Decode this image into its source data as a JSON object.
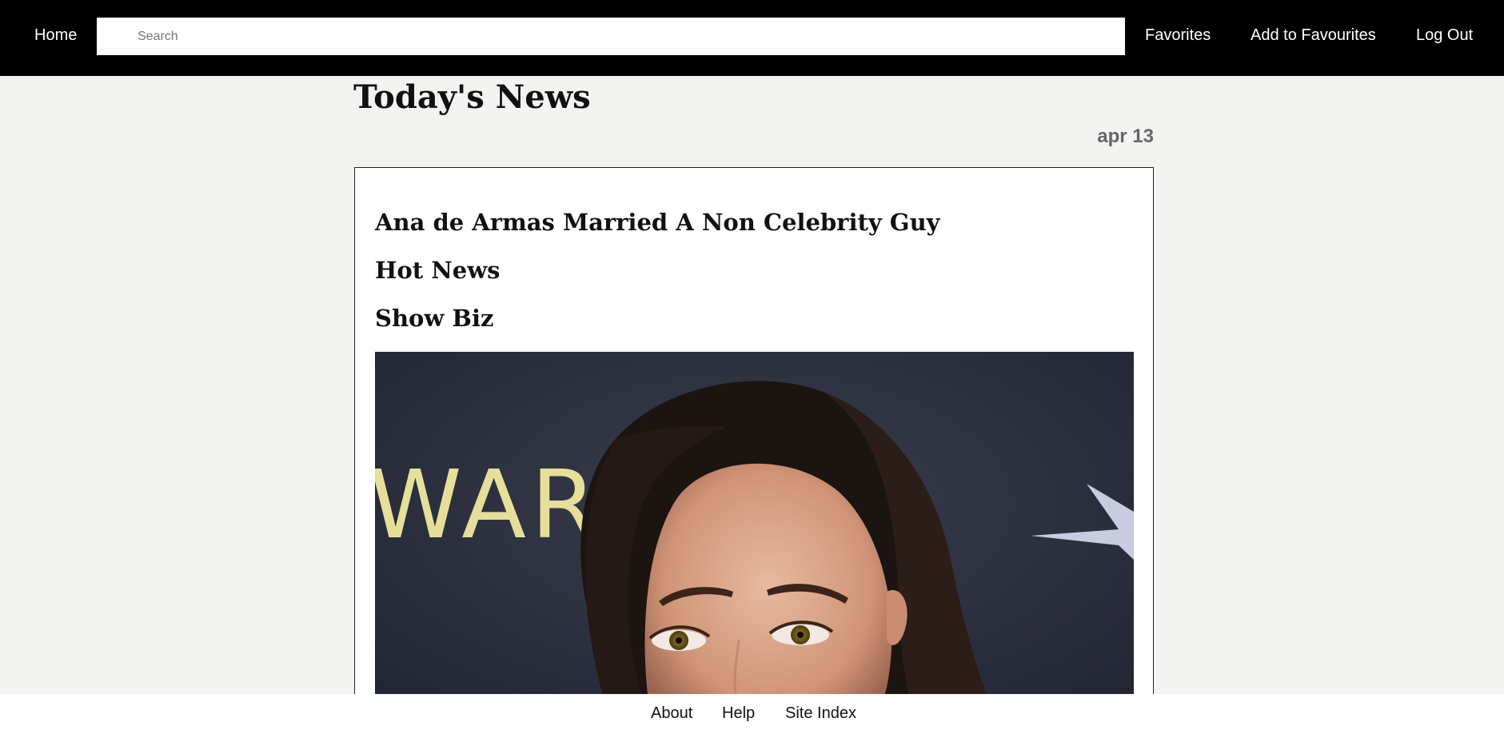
{
  "nav": {
    "home": "Home",
    "search_placeholder": "Search",
    "search_value": "",
    "favorites": "Favorites",
    "add_to_favourites": "Add to Favourites",
    "log_out": "Log Out"
  },
  "page": {
    "title": "Today's News",
    "date": "apr 13"
  },
  "article": {
    "headline": "Ana de Armas Married A Non Celebrity Guy",
    "category": "Hot News",
    "section": "Show Biz",
    "image": {
      "subject": "woman-portrait-photo",
      "backdrop_text": "WAR"
    }
  },
  "footer": {
    "links": [
      "About",
      "Help",
      "Site Index"
    ]
  },
  "colors": {
    "topbar_bg": "#000000",
    "page_bg": "#f3f3f1",
    "card_bg": "#ffffff",
    "date_text": "#666666",
    "backdrop_text": "#e6df9a"
  }
}
